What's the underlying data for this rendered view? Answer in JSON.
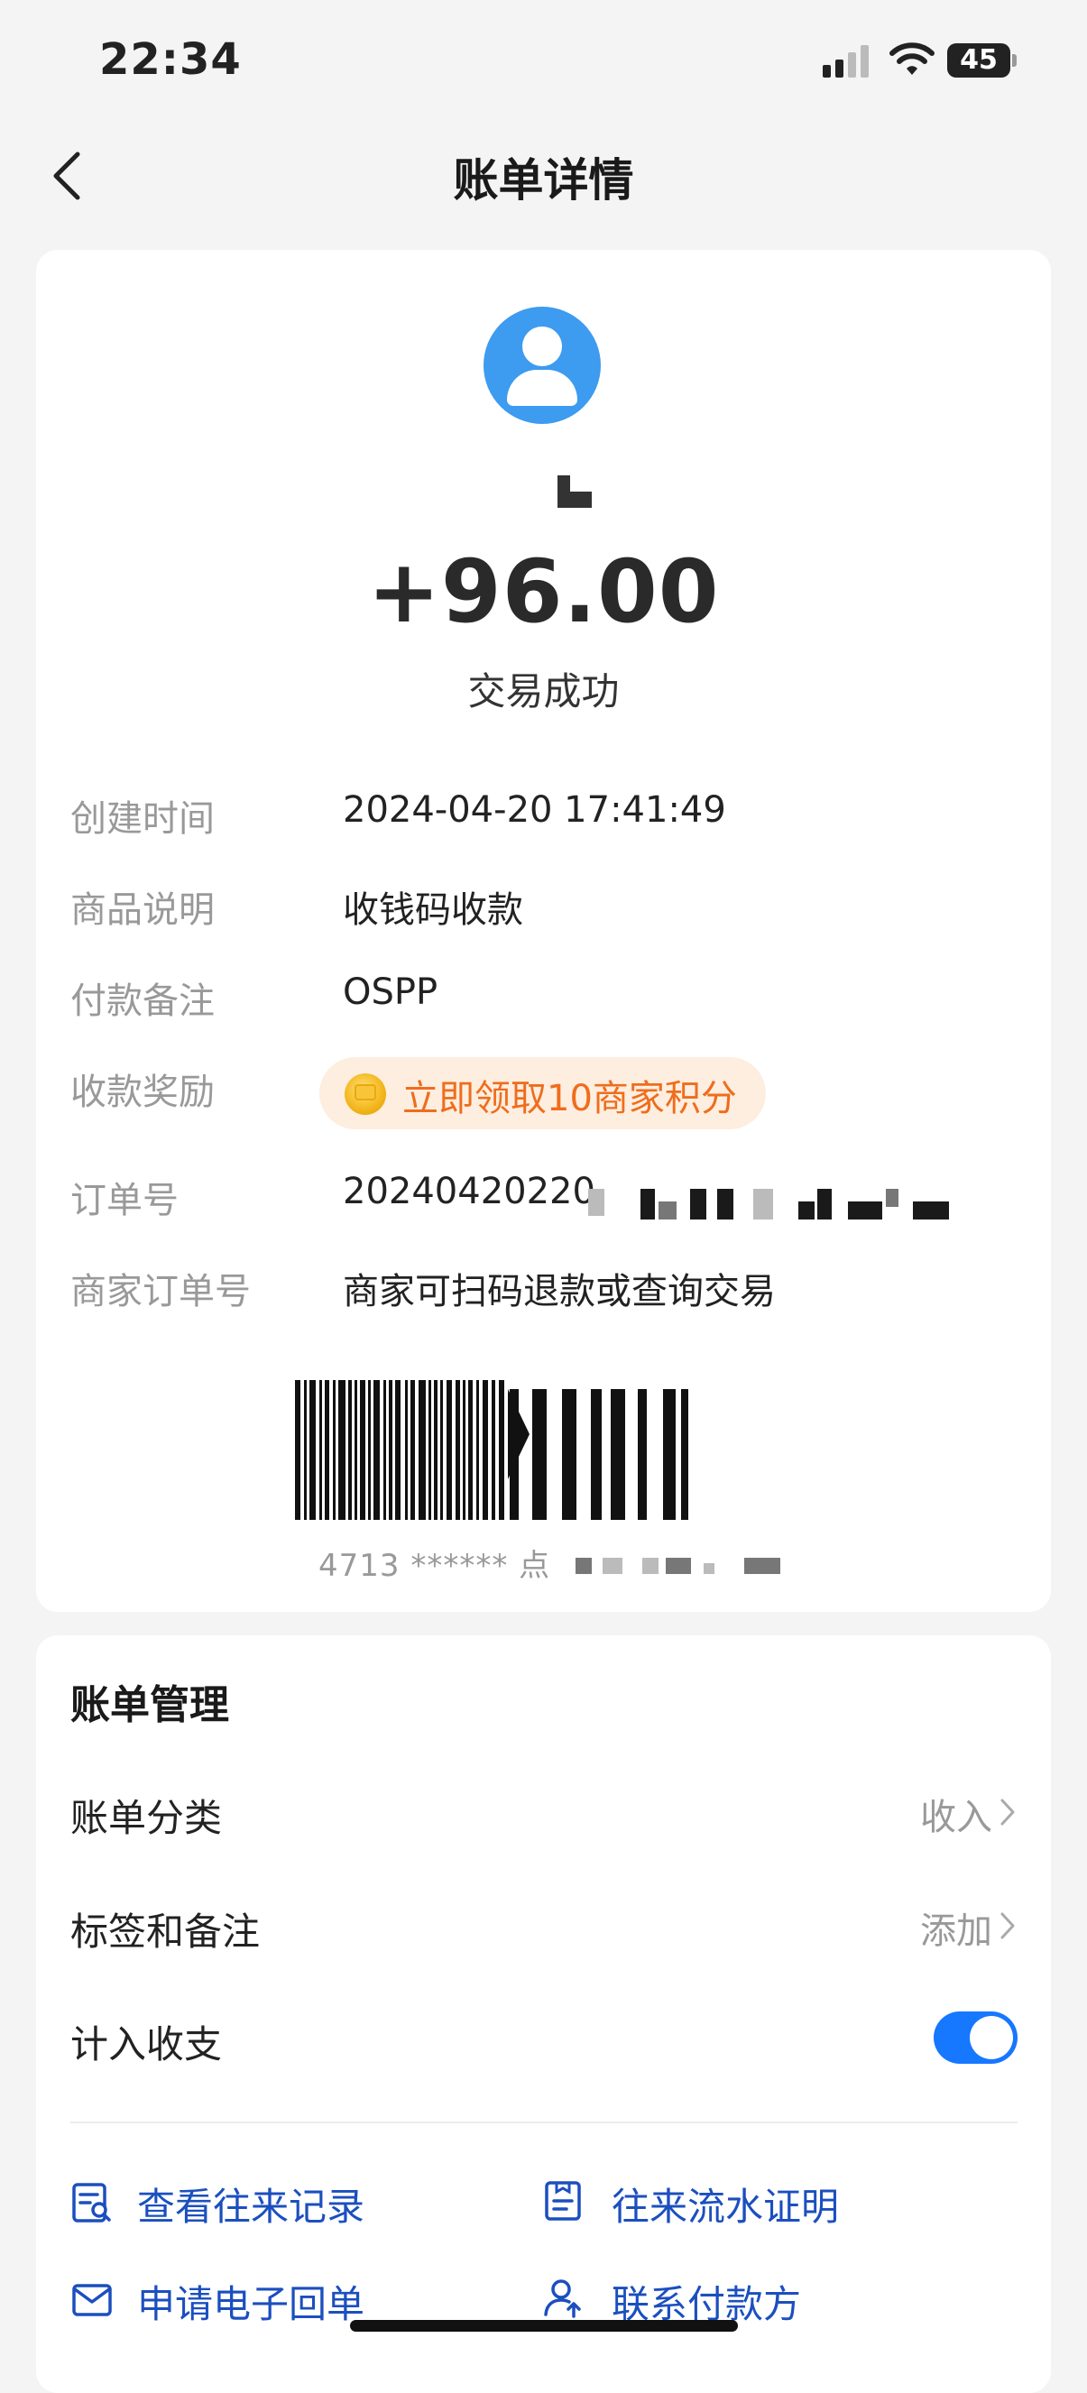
{
  "status_bar": {
    "time": "22:34",
    "battery": "45"
  },
  "nav": {
    "title": "账单详情"
  },
  "transaction": {
    "amount": "+96.00",
    "status": "交易成功"
  },
  "details": {
    "created_label": "创建时间",
    "created_value": "2024-04-20 17:41:49",
    "goods_label": "商品说明",
    "goods_value": "收钱码收款",
    "memo_label": "付款备注",
    "memo_value": "OSPP",
    "reward_label": "收款奖励",
    "reward_value": "立即领取10商家积分",
    "order_label": "订单号",
    "order_value": "20240420220",
    "merchant_order_label": "商家订单号",
    "merchant_order_value": "商家可扫码退款或查询交易"
  },
  "barcode": {
    "text": "4713 ****** 点"
  },
  "management": {
    "title": "账单管理",
    "category_label": "账单分类",
    "category_value": "收入",
    "tags_label": "标签和备注",
    "tags_value": "添加",
    "include_label": "计入收支",
    "include_on": true
  },
  "links": {
    "records": "查看往来记录",
    "proof": "往来流水证明",
    "receipt": "申请电子回单",
    "contact": "联系付款方"
  },
  "colors": {
    "accent": "#1677ff",
    "link": "#1b4fbf",
    "reward": "#ef6d1c",
    "avatar": "#3d9bf0"
  }
}
